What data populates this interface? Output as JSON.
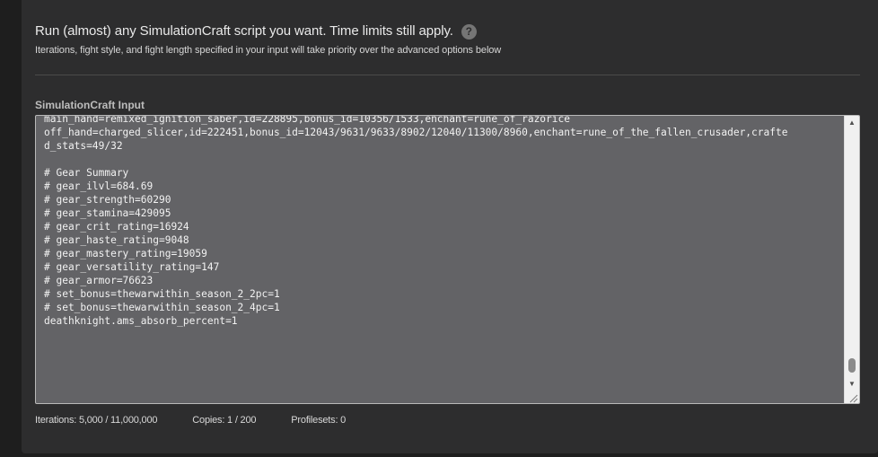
{
  "header": {
    "title": "Run (almost) any SimulationCraft script you want. Time limits still apply.",
    "help_icon": "?",
    "subtitle": "Iterations, fight style, and fight length specified in your input will take priority over the advanced options below"
  },
  "input": {
    "label": "SimulationCraft Input",
    "lines": [
      "main_hand=remixed_ignition_saber,id=228895,bonus_id=10356/1533,enchant=rune_of_razorice",
      "off_hand=charged_slicer,id=222451,bonus_id=12043/9631/9633/8902/12040/11300/8960,enchant=rune_of_the_fallen_crusader,crafte",
      "d_stats=49/32",
      "",
      "# Gear Summary",
      "# gear_ilvl=684.69",
      "# gear_strength=60290",
      "# gear_stamina=429095",
      "# gear_crit_rating=16924",
      "# gear_haste_rating=9048",
      "# gear_mastery_rating=19059",
      "# gear_versatility_rating=147",
      "# gear_armor=76623",
      "# set_bonus=thewarwithin_season_2_2pc=1",
      "# set_bonus=thewarwithin_season_2_4pc=1",
      "deathknight.ams_absorb_percent=1"
    ]
  },
  "footer": {
    "iterations": "Iterations: 5,000 / 11,000,000",
    "copies": "Copies: 1 / 200",
    "profilesets": "Profilesets: 0"
  },
  "icons": {
    "scroll_up": "chevron-up-icon",
    "scroll_down": "chevron-down-icon",
    "resize": "resize-grip-icon"
  }
}
